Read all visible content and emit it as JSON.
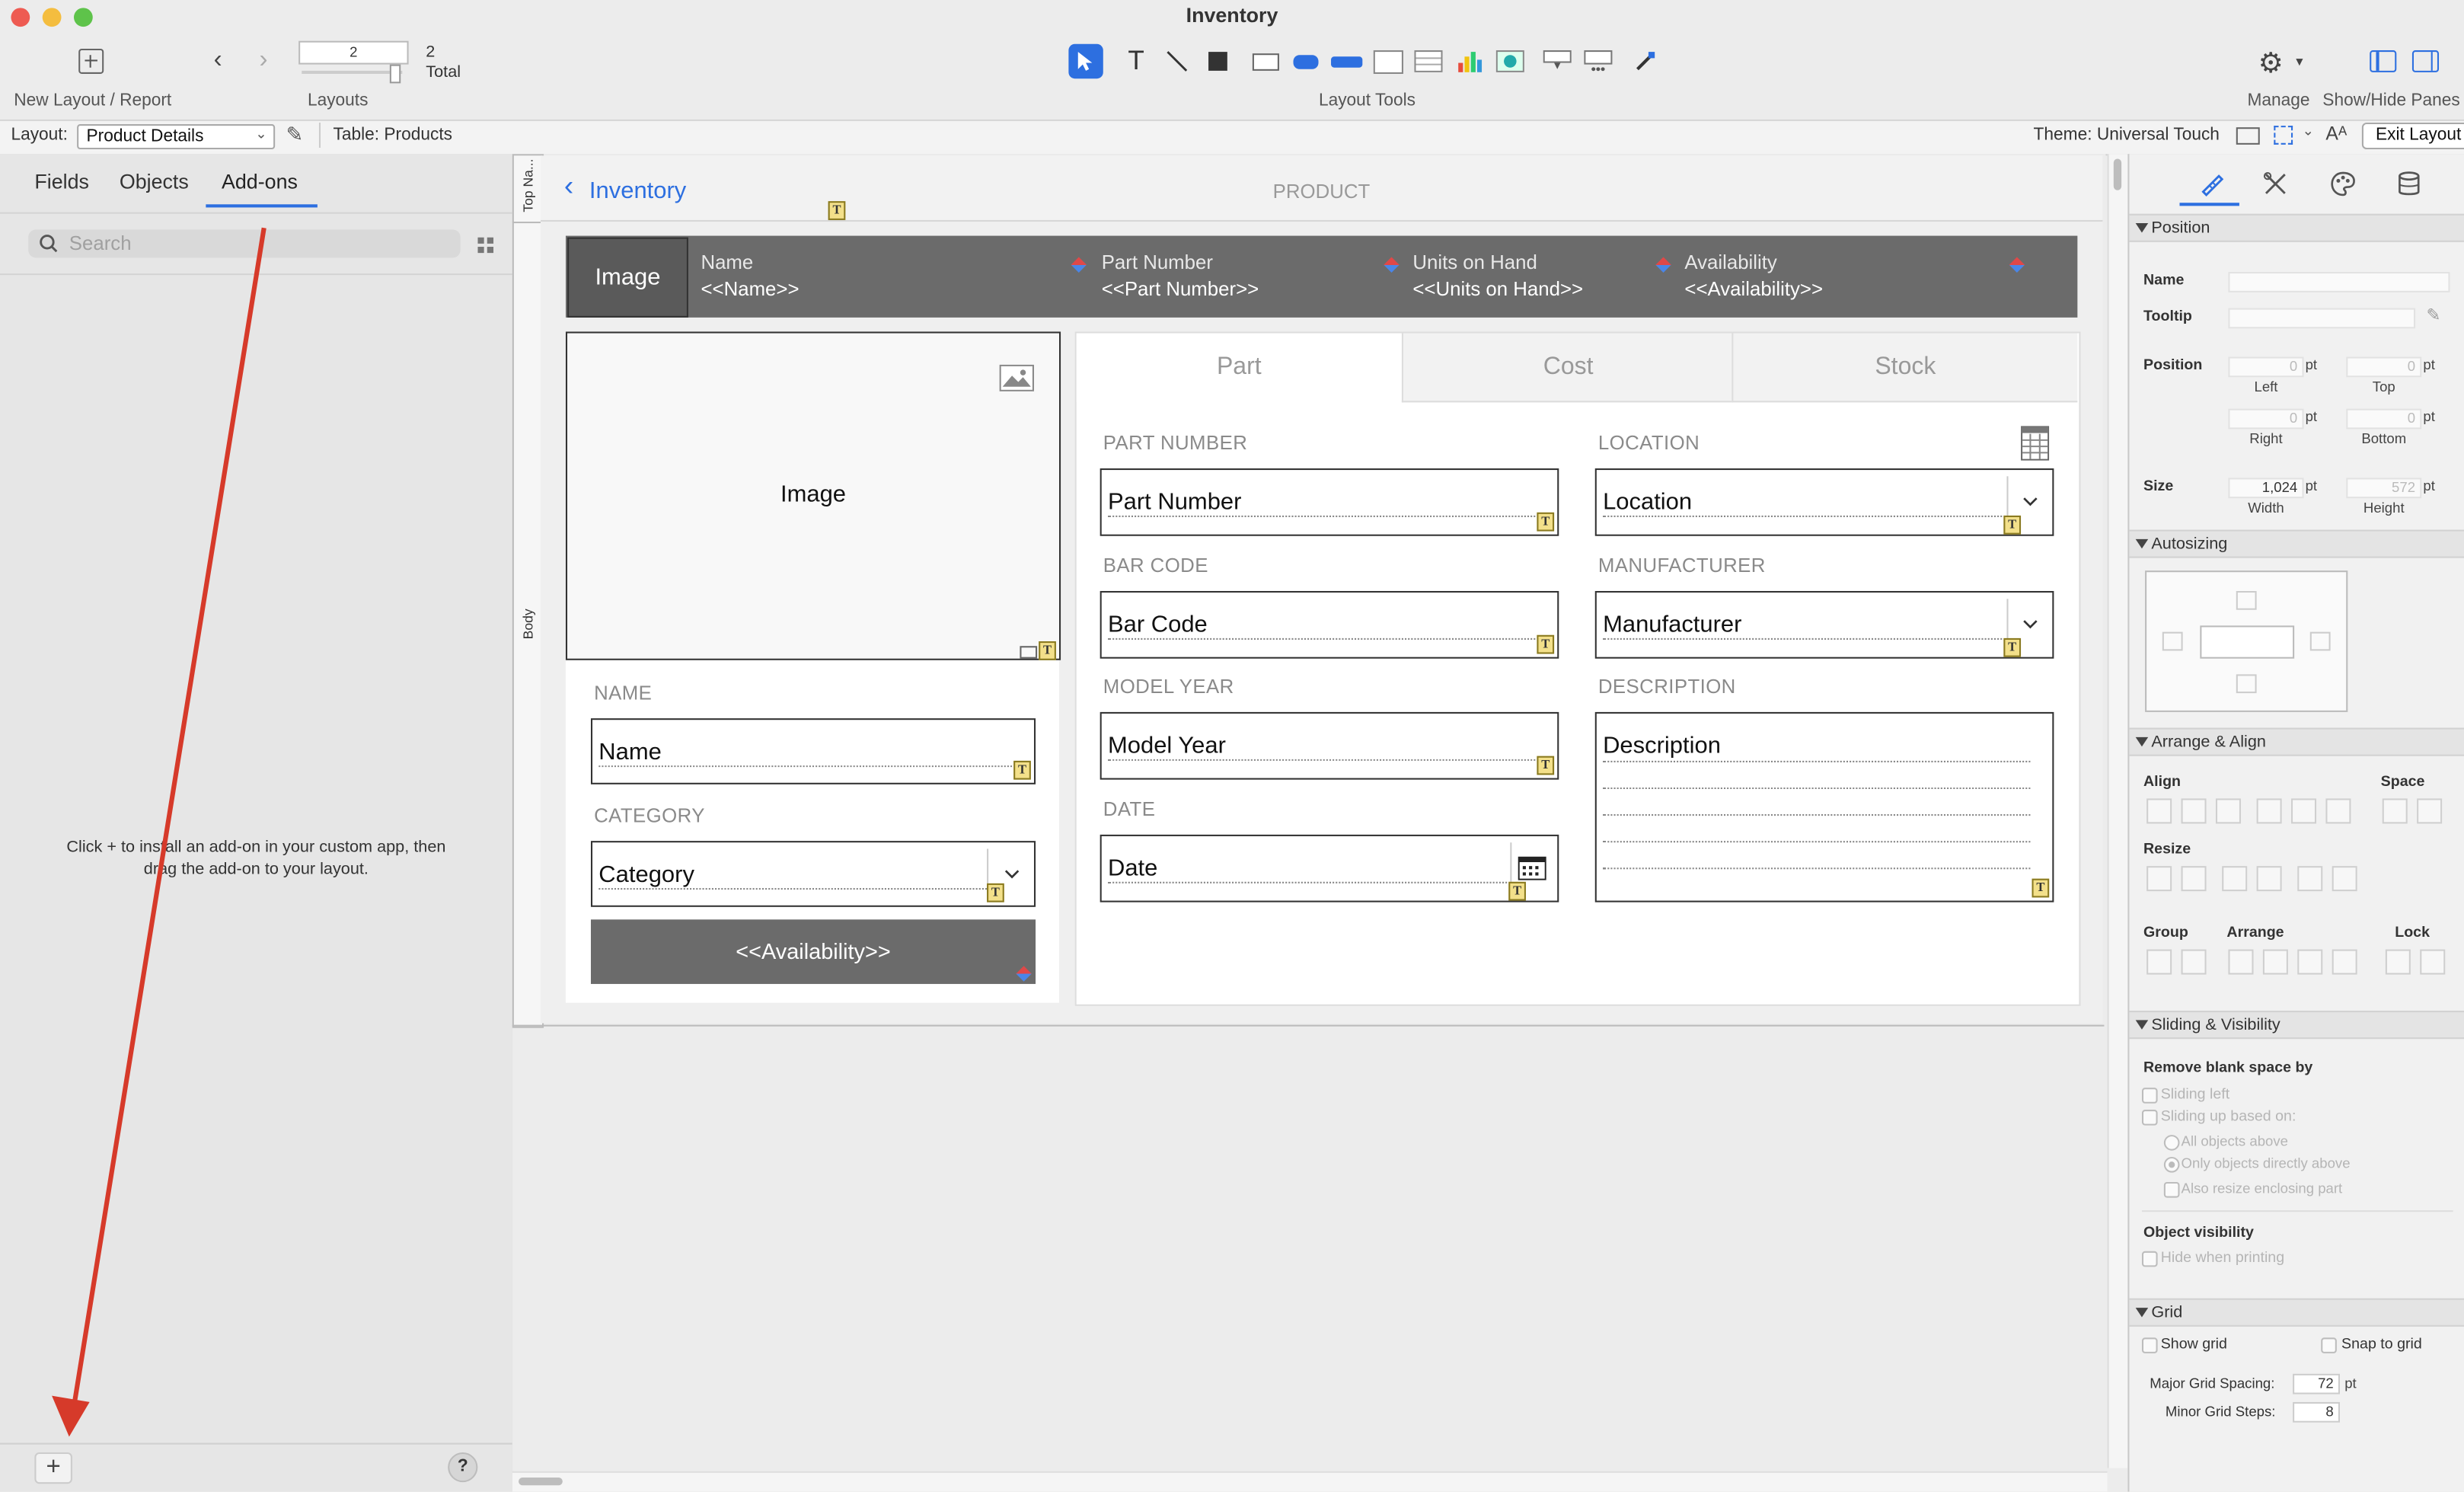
{
  "window": {
    "title": "Inventory"
  },
  "toolbar": {
    "new_layout_label": "New Layout / Report",
    "layouts_label": "Layouts",
    "layout_number": "2",
    "layout_total_count": "2",
    "layout_total_label": "Total",
    "layout_tools_label": "Layout Tools",
    "manage_label": "Manage",
    "show_hide_label": "Show/Hide Panes",
    "tool_icons": [
      "select-pointer-icon",
      "text-tool-icon",
      "line-tool-icon",
      "rectangle-tool-icon",
      "field-tool-icon",
      "button-tool-icon",
      "button-bar-tool-icon",
      "tab-control-tool-icon",
      "portal-tool-icon",
      "chart-tool-icon",
      "web-viewer-tool-icon",
      "popover-tool-icon",
      "slide-control-tool-icon",
      "format-painter-icon"
    ]
  },
  "layout_bar": {
    "layout_prefix": "Layout:",
    "layout_name": "Product Details",
    "table_text": "Table: Products",
    "theme_text": "Theme: Universal Touch",
    "exit_label": "Exit Layout"
  },
  "left_pane": {
    "tabs": [
      "Fields",
      "Objects",
      "Add-ons"
    ],
    "active_tab": "Add-ons",
    "search_placeholder": "Search",
    "message_line1": "Click + to install an add-on in your custom app, then",
    "message_line2": "drag the add-on to your layout.",
    "add_label": "+",
    "help_label": "?"
  },
  "parts": {
    "top_nav": "Top Na...",
    "body": "Body"
  },
  "layout": {
    "nav_back_label": "Inventory",
    "nav_title": "PRODUCT",
    "header": {
      "image_label": "Image",
      "name_title": "Name",
      "name_value": "<<Name>>",
      "part_title": "Part Number",
      "part_value": "<<Part Number>>",
      "units_title": "Units on Hand",
      "units_value": "<<Units on Hand>>",
      "avail_title": "Availability",
      "avail_value": "<<Availability>>"
    },
    "image_box_label": "Image",
    "left_fields": {
      "name_label": "NAME",
      "name_value": "Name",
      "category_label": "CATEGORY",
      "category_value": "Category",
      "availability_button": "<<Availability>>"
    },
    "tabs": [
      "Part",
      "Cost",
      "Stock"
    ],
    "active_tab": "Part",
    "part_fields": {
      "part_number_label": "PART NUMBER",
      "part_number_value": "Part Number",
      "bar_code_label": "BAR CODE",
      "bar_code_value": "Bar Code",
      "model_year_label": "MODEL YEAR",
      "model_year_value": "Model Year",
      "date_label": "DATE",
      "date_value": "Date",
      "location_label": "LOCATION",
      "location_value": "Location",
      "manufacturer_label": "MANUFACTURER",
      "manufacturer_value": "Manufacturer",
      "description_label": "DESCRIPTION",
      "description_value": "Description"
    }
  },
  "inspector": {
    "tab_icons": [
      "position-ruler-icon",
      "appearance-tools-icon",
      "palette-icon",
      "data-cylinder-icon"
    ],
    "position_section": "Position",
    "name_label": "Name",
    "tooltip_label": "Tooltip",
    "position_label": "Position",
    "left_value": "0",
    "top_value": "0",
    "right_value": "0",
    "bottom_value": "0",
    "unit": "pt",
    "left_label": "Left",
    "top_label": "Top",
    "right_label": "Right",
    "bottom_label": "Bottom",
    "size_label": "Size",
    "width_value": "1,024",
    "height_value": "572",
    "width_label": "Width",
    "height_label": "Height",
    "autosizing_section": "Autosizing",
    "arrange_section": "Arrange & Align",
    "align_label": "Align",
    "space_label": "Space",
    "resize_label": "Resize",
    "group_label": "Group",
    "arrange_label": "Arrange",
    "lock_label": "Lock",
    "sliding_section": "Sliding & Visibility",
    "remove_blank_label": "Remove blank space by",
    "sliding_left": "Sliding left",
    "sliding_up": "Sliding up based on:",
    "all_objects_above": "All objects above",
    "only_objects_directly_above": "Only objects directly above",
    "also_resize": "Also resize enclosing part",
    "object_visibility_label": "Object visibility",
    "hide_when_printing": "Hide when printing",
    "grid_section": "Grid",
    "show_grid": "Show grid",
    "snap_to_grid": "Snap to grid",
    "major_spacing_label": "Major Grid Spacing:",
    "major_spacing_value": "72",
    "minor_steps_label": "Minor Grid Steps:",
    "minor_steps_value": "8"
  },
  "colors": {
    "accent": "#2f6fe0",
    "header_bg": "#6b6b6b",
    "annotation_arrow": "#d63a2a"
  }
}
